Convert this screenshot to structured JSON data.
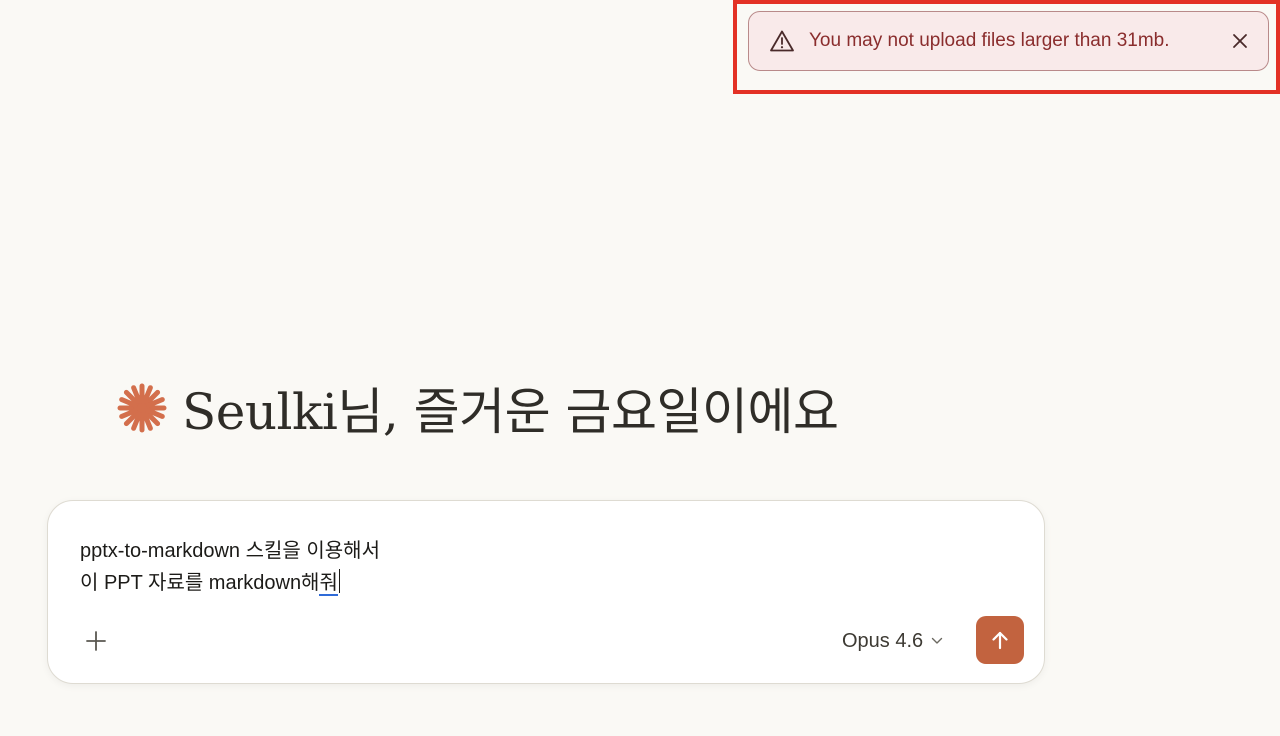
{
  "toast": {
    "message": "You may not upload files larger than 31mb.",
    "icon": "warning-triangle-icon",
    "close_icon": "close-icon",
    "highlight_color": "#e33125"
  },
  "greeting": {
    "logo_icon": "sparkle-asterisk-icon",
    "text": "Seulki님, 즐거운 금요일이에요",
    "logo_color": "#d36f4c"
  },
  "composer": {
    "line1": "pptx-to-markdown 스킬을 이용해서",
    "line2_prefix": "이 PPT 자료를 markdown해",
    "line2_composing": "줘",
    "add_icon": "plus-icon",
    "model_label": "Opus 4.6",
    "model_chevron_icon": "chevron-down-icon",
    "send_icon": "arrow-up-icon",
    "send_color": "#c2633f"
  }
}
